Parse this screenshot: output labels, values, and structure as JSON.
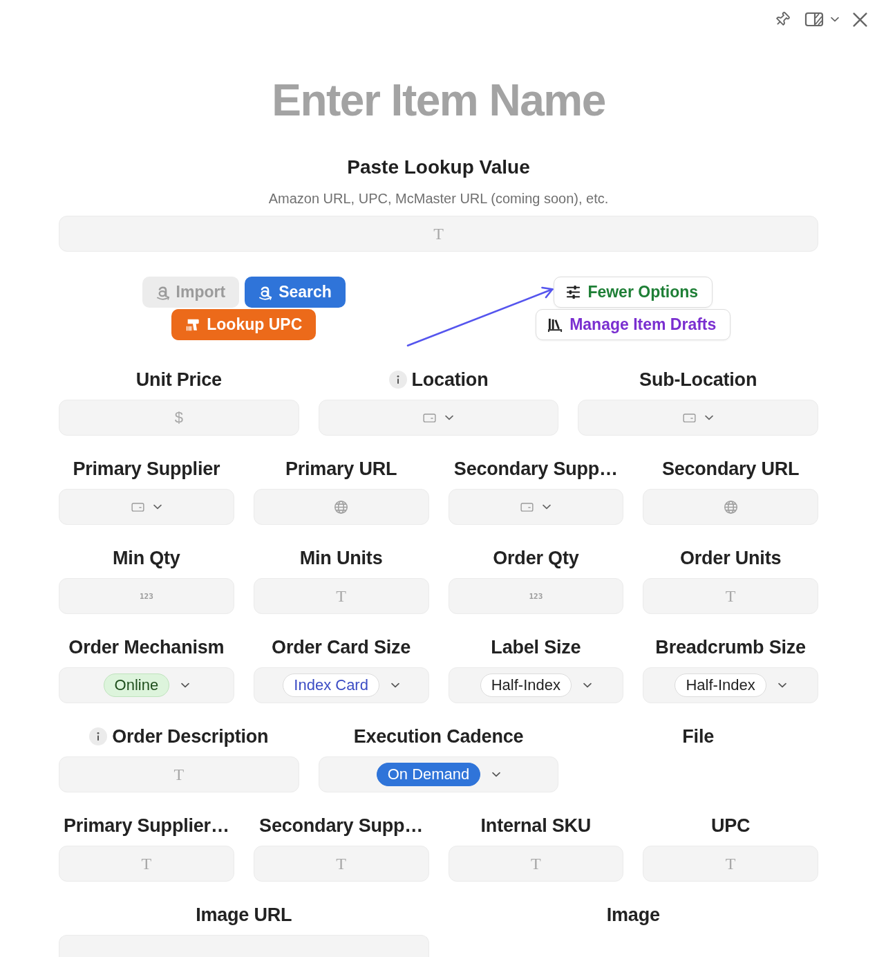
{
  "item_name": {
    "placeholder": "Enter Item Name"
  },
  "lookup": {
    "title": "Paste Lookup Value",
    "hint": "Amazon URL, UPC, McMaster URL (coming soon), etc.",
    "input": {
      "kind": "text",
      "glyph": "T"
    }
  },
  "action_groups": [
    {
      "rows": [
        [
          {
            "label": "Import",
            "kind": "filled",
            "disabled": true
          },
          {
            "label": "Search",
            "kind": "filled",
            "color": "#2f74d9",
            "disabled": false
          }
        ],
        [
          {
            "label": "Lookup UPC",
            "kind": "filled",
            "color": "#ec6a1a",
            "disabled": false
          }
        ]
      ]
    },
    {
      "rows": [
        [
          {
            "label": "Fewer Options",
            "kind": "outline",
            "color": "#1e7f36",
            "disabled": false
          }
        ],
        [
          {
            "label": "Manage Item Drafts",
            "kind": "outline",
            "color": "#7a2fd0",
            "disabled": false
          }
        ]
      ]
    }
  ],
  "field_rows": [
    {
      "fields": [
        {
          "label": "Unit Price",
          "info": false,
          "input": {
            "kind": "currency",
            "glyph": "$"
          }
        },
        {
          "label": "Location",
          "info": true,
          "input": {
            "kind": "select"
          }
        },
        {
          "label": "Sub-Location",
          "info": false,
          "input": {
            "kind": "select"
          }
        }
      ]
    },
    {
      "fields": [
        {
          "label": "Primary Supplier",
          "info": false,
          "input": {
            "kind": "select"
          }
        },
        {
          "label": "Primary URL",
          "info": false,
          "input": {
            "kind": "url"
          }
        },
        {
          "label": "Secondary Supp…",
          "info": false,
          "input": {
            "kind": "select"
          }
        },
        {
          "label": "Secondary URL",
          "info": false,
          "input": {
            "kind": "url"
          }
        }
      ]
    },
    {
      "fields": [
        {
          "label": "Min Qty",
          "info": false,
          "input": {
            "kind": "number",
            "glyph": "123"
          }
        },
        {
          "label": "Min Units",
          "info": false,
          "input": {
            "kind": "text",
            "glyph": "T"
          }
        },
        {
          "label": "Order Qty",
          "info": false,
          "input": {
            "kind": "number",
            "glyph": "123"
          }
        },
        {
          "label": "Order Units",
          "info": false,
          "input": {
            "kind": "text",
            "glyph": "T"
          }
        }
      ]
    },
    {
      "fields": [
        {
          "label": "Order Mechanism",
          "info": false,
          "input": {
            "kind": "tags",
            "chip": {
              "label": "Online",
              "kind": "soft",
              "color": "#ddf4dc"
            }
          }
        },
        {
          "label": "Order Card Size",
          "info": false,
          "input": {
            "kind": "tags",
            "chip": {
              "label": "Index Card",
              "kind": "outline",
              "color": "#3b4cc4"
            }
          }
        },
        {
          "label": "Label Size",
          "info": false,
          "input": {
            "kind": "tags",
            "chip": {
              "label": "Half-Index",
              "kind": "outline",
              "color": "#222222"
            }
          }
        },
        {
          "label": "Breadcrumb Size",
          "info": false,
          "input": {
            "kind": "tags",
            "chip": {
              "label": "Half-Index",
              "kind": "outline",
              "color": "#222222"
            }
          }
        }
      ]
    },
    {
      "fields": [
        {
          "label": "Order Description",
          "info": true,
          "input": {
            "kind": "text",
            "glyph": "T"
          }
        },
        {
          "label": "Execution Cadence",
          "info": false,
          "input": {
            "kind": "tags",
            "chip": {
              "label": "On Demand",
              "kind": "solid",
              "color": "#2f74d9"
            }
          }
        },
        {
          "label": "File",
          "info": false
        }
      ]
    },
    {
      "fields": [
        {
          "label": "Primary Supplier…",
          "info": false,
          "input": {
            "kind": "text",
            "glyph": "T"
          }
        },
        {
          "label": "Secondary Supp…",
          "info": false,
          "input": {
            "kind": "text",
            "glyph": "T"
          }
        },
        {
          "label": "Internal SKU",
          "info": false,
          "input": {
            "kind": "text",
            "glyph": "T"
          }
        },
        {
          "label": "UPC",
          "info": false,
          "input": {
            "kind": "text",
            "glyph": "T"
          }
        }
      ]
    },
    {
      "fields": [
        {
          "label": "Image URL",
          "info": false,
          "input": {
            "kind": "text"
          }
        },
        {
          "label": "Image",
          "info": false
        }
      ]
    }
  ]
}
